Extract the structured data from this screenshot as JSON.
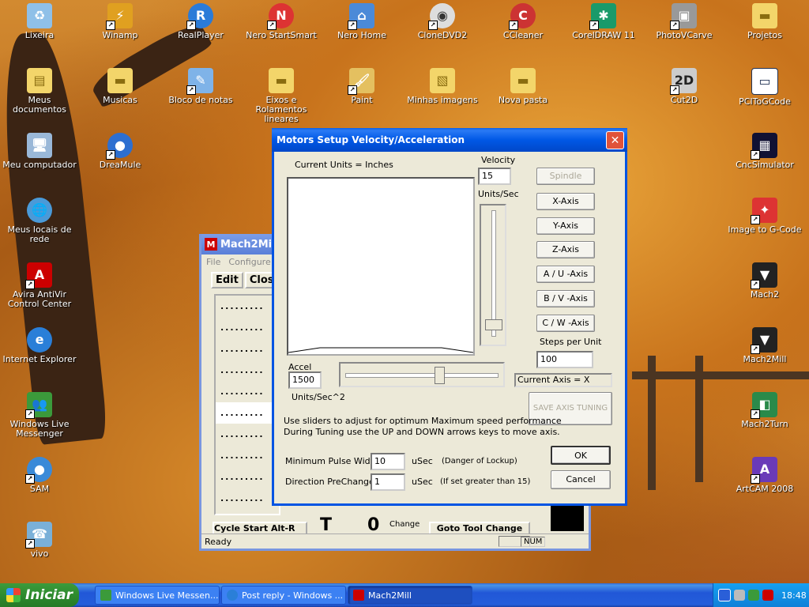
{
  "desktop": {
    "icons": [
      {
        "label": "Lixeira",
        "icon": "recycle-bin-icon"
      },
      {
        "label": "Winamp",
        "icon": "winamp-icon"
      },
      {
        "label": "RealPlayer",
        "icon": "realplayer-icon"
      },
      {
        "label": "Nero StartSmart",
        "icon": "nero-icon"
      },
      {
        "label": "Nero Home",
        "icon": "nero-home-icon"
      },
      {
        "label": "CloneDVD2",
        "icon": "clonedvd-icon"
      },
      {
        "label": "CCleaner",
        "icon": "ccleaner-icon"
      },
      {
        "label": "CorelDRAW 11",
        "icon": "coreldraw-icon"
      },
      {
        "label": "PhotoVCarve",
        "icon": "photovcarve-icon"
      },
      {
        "label": "Projetos",
        "icon": "folder-icon"
      },
      {
        "label": "Meus documentos",
        "icon": "my-documents-icon"
      },
      {
        "label": "Musicas",
        "icon": "folder-icon"
      },
      {
        "label": "Bloco de notas",
        "icon": "notepad-icon"
      },
      {
        "label": "Eixos e Rolamentos lineares",
        "icon": "folder-icon"
      },
      {
        "label": "Paint",
        "icon": "paint-icon"
      },
      {
        "label": "Minhas imagens",
        "icon": "my-pictures-icon"
      },
      {
        "label": "Nova pasta",
        "icon": "folder-icon"
      },
      {
        "label": "Cut2D",
        "icon": "cut2d-icon"
      },
      {
        "label": "PCIToGCode",
        "icon": "pcitogcode-icon"
      },
      {
        "label": "Meu computador",
        "icon": "my-computer-icon"
      },
      {
        "label": "DreaMule",
        "icon": "dreamule-icon"
      },
      {
        "label": "CncSimulator",
        "icon": "cncsimulator-icon"
      },
      {
        "label": "Meus locais de rede",
        "icon": "network-icon"
      },
      {
        "label": "Image to G-Code",
        "icon": "image-to-gcode-icon"
      },
      {
        "label": "Avira AntiVir Control Center",
        "icon": "avira-icon"
      },
      {
        "label": "Mach2",
        "icon": "mach2-icon"
      },
      {
        "label": "Internet Explorer",
        "icon": "ie-icon"
      },
      {
        "label": "Mach2Mill",
        "icon": "mach2mill-icon"
      },
      {
        "label": "Windows Live Messenger",
        "icon": "messenger-icon"
      },
      {
        "label": "Mach2Turn",
        "icon": "mach2turn-icon"
      },
      {
        "label": "SAM",
        "icon": "sam-icon"
      },
      {
        "label": "ArtCAM 2008",
        "icon": "artcam-icon"
      },
      {
        "label": "vivo",
        "icon": "vivo-icon"
      }
    ]
  },
  "mach": {
    "title": "Mach2Mill",
    "menu": {
      "file": "File",
      "configure": "Configure"
    },
    "toolbar": {
      "edit": "Edit",
      "close": "Close"
    },
    "dots": ".........",
    "bottom": {
      "left": "Cycle Start Alt-R",
      "change": "Change",
      "goto": "Goto Tool Change",
      "t": "T",
      "zero": "0"
    },
    "status": {
      "ready": "Ready",
      "num": "NUM"
    }
  },
  "dialog": {
    "title": "Motors Setup Velocity/Acceleration",
    "current_units": "Current Units =  Inches",
    "velocity_label": "Velocity",
    "velocity_value": "15",
    "units_per_sec": "Units/Sec",
    "accel_label": "Accel",
    "accel_value": "1500",
    "accel_units": "Units/Sec^2",
    "buttons": {
      "spindle": "Spindle",
      "x": "X-Axis",
      "y": "Y-Axis",
      "z": "Z-Axis",
      "a": "A / U -Axis",
      "b": "B / V -Axis",
      "c": "C / W -Axis"
    },
    "steps_label": "Steps per Unit",
    "steps_value": "100",
    "current_axis": "Current Axis = X",
    "save_axis": "SAVE AXIS TUNING",
    "instructions_1": "Use sliders to adjust for optimum Maximum speed performance",
    "instructions_2": "During Tuning use the UP and DOWN arrows keys to move axis.",
    "min_pulse_label": "Minimum Pulse Width",
    "min_pulse_value": "10",
    "min_pulse_unit": "uSec",
    "min_pulse_note": "(Danger of Lockup)",
    "dir_label": "Direction PreChange",
    "dir_value": "1",
    "dir_unit": "uSec",
    "dir_note": "(If set greater than 15)",
    "ok": "OK",
    "cancel": "Cancel",
    "velocity_slider_fraction": 0.08,
    "accel_slider_fraction": 0.62
  },
  "taskbar": {
    "start": "Iniciar",
    "tasks": [
      {
        "label": "Windows Live Messen...",
        "icon": "messenger-icon"
      },
      {
        "label": "Post reply - Windows ...",
        "icon": "ie-icon"
      },
      {
        "label": "Mach2Mill",
        "icon": "mach2mill-icon"
      }
    ],
    "clock": "18:48"
  },
  "colors": {
    "desktop_accent": "#c8731c",
    "title_blue": "#0054e3",
    "taskbar_blue": "#245edb",
    "start_green": "#2e8b2e",
    "close_red": "#e0533a"
  }
}
